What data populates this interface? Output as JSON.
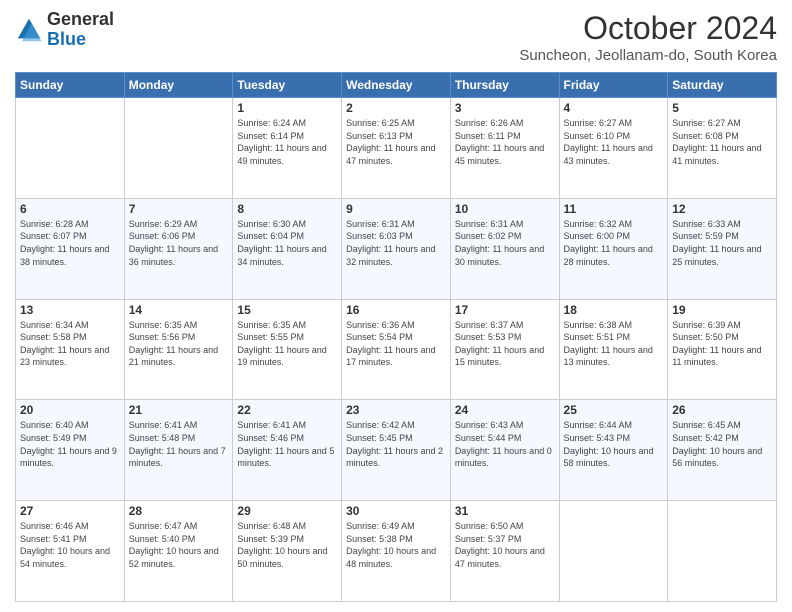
{
  "logo": {
    "general": "General",
    "blue": "Blue"
  },
  "header": {
    "month": "October 2024",
    "location": "Suncheon, Jeollanam-do, South Korea"
  },
  "weekdays": [
    "Sunday",
    "Monday",
    "Tuesday",
    "Wednesday",
    "Thursday",
    "Friday",
    "Saturday"
  ],
  "weeks": [
    [
      {
        "day": "",
        "data": ""
      },
      {
        "day": "",
        "data": ""
      },
      {
        "day": "1",
        "data": "Sunrise: 6:24 AM\nSunset: 6:14 PM\nDaylight: 11 hours and 49 minutes."
      },
      {
        "day": "2",
        "data": "Sunrise: 6:25 AM\nSunset: 6:13 PM\nDaylight: 11 hours and 47 minutes."
      },
      {
        "day": "3",
        "data": "Sunrise: 6:26 AM\nSunset: 6:11 PM\nDaylight: 11 hours and 45 minutes."
      },
      {
        "day": "4",
        "data": "Sunrise: 6:27 AM\nSunset: 6:10 PM\nDaylight: 11 hours and 43 minutes."
      },
      {
        "day": "5",
        "data": "Sunrise: 6:27 AM\nSunset: 6:08 PM\nDaylight: 11 hours and 41 minutes."
      }
    ],
    [
      {
        "day": "6",
        "data": "Sunrise: 6:28 AM\nSunset: 6:07 PM\nDaylight: 11 hours and 38 minutes."
      },
      {
        "day": "7",
        "data": "Sunrise: 6:29 AM\nSunset: 6:06 PM\nDaylight: 11 hours and 36 minutes."
      },
      {
        "day": "8",
        "data": "Sunrise: 6:30 AM\nSunset: 6:04 PM\nDaylight: 11 hours and 34 minutes."
      },
      {
        "day": "9",
        "data": "Sunrise: 6:31 AM\nSunset: 6:03 PM\nDaylight: 11 hours and 32 minutes."
      },
      {
        "day": "10",
        "data": "Sunrise: 6:31 AM\nSunset: 6:02 PM\nDaylight: 11 hours and 30 minutes."
      },
      {
        "day": "11",
        "data": "Sunrise: 6:32 AM\nSunset: 6:00 PM\nDaylight: 11 hours and 28 minutes."
      },
      {
        "day": "12",
        "data": "Sunrise: 6:33 AM\nSunset: 5:59 PM\nDaylight: 11 hours and 25 minutes."
      }
    ],
    [
      {
        "day": "13",
        "data": "Sunrise: 6:34 AM\nSunset: 5:58 PM\nDaylight: 11 hours and 23 minutes."
      },
      {
        "day": "14",
        "data": "Sunrise: 6:35 AM\nSunset: 5:56 PM\nDaylight: 11 hours and 21 minutes."
      },
      {
        "day": "15",
        "data": "Sunrise: 6:35 AM\nSunset: 5:55 PM\nDaylight: 11 hours and 19 minutes."
      },
      {
        "day": "16",
        "data": "Sunrise: 6:36 AM\nSunset: 5:54 PM\nDaylight: 11 hours and 17 minutes."
      },
      {
        "day": "17",
        "data": "Sunrise: 6:37 AM\nSunset: 5:53 PM\nDaylight: 11 hours and 15 minutes."
      },
      {
        "day": "18",
        "data": "Sunrise: 6:38 AM\nSunset: 5:51 PM\nDaylight: 11 hours and 13 minutes."
      },
      {
        "day": "19",
        "data": "Sunrise: 6:39 AM\nSunset: 5:50 PM\nDaylight: 11 hours and 11 minutes."
      }
    ],
    [
      {
        "day": "20",
        "data": "Sunrise: 6:40 AM\nSunset: 5:49 PM\nDaylight: 11 hours and 9 minutes."
      },
      {
        "day": "21",
        "data": "Sunrise: 6:41 AM\nSunset: 5:48 PM\nDaylight: 11 hours and 7 minutes."
      },
      {
        "day": "22",
        "data": "Sunrise: 6:41 AM\nSunset: 5:46 PM\nDaylight: 11 hours and 5 minutes."
      },
      {
        "day": "23",
        "data": "Sunrise: 6:42 AM\nSunset: 5:45 PM\nDaylight: 11 hours and 2 minutes."
      },
      {
        "day": "24",
        "data": "Sunrise: 6:43 AM\nSunset: 5:44 PM\nDaylight: 11 hours and 0 minutes."
      },
      {
        "day": "25",
        "data": "Sunrise: 6:44 AM\nSunset: 5:43 PM\nDaylight: 10 hours and 58 minutes."
      },
      {
        "day": "26",
        "data": "Sunrise: 6:45 AM\nSunset: 5:42 PM\nDaylight: 10 hours and 56 minutes."
      }
    ],
    [
      {
        "day": "27",
        "data": "Sunrise: 6:46 AM\nSunset: 5:41 PM\nDaylight: 10 hours and 54 minutes."
      },
      {
        "day": "28",
        "data": "Sunrise: 6:47 AM\nSunset: 5:40 PM\nDaylight: 10 hours and 52 minutes."
      },
      {
        "day": "29",
        "data": "Sunrise: 6:48 AM\nSunset: 5:39 PM\nDaylight: 10 hours and 50 minutes."
      },
      {
        "day": "30",
        "data": "Sunrise: 6:49 AM\nSunset: 5:38 PM\nDaylight: 10 hours and 48 minutes."
      },
      {
        "day": "31",
        "data": "Sunrise: 6:50 AM\nSunset: 5:37 PM\nDaylight: 10 hours and 47 minutes."
      },
      {
        "day": "",
        "data": ""
      },
      {
        "day": "",
        "data": ""
      }
    ]
  ]
}
